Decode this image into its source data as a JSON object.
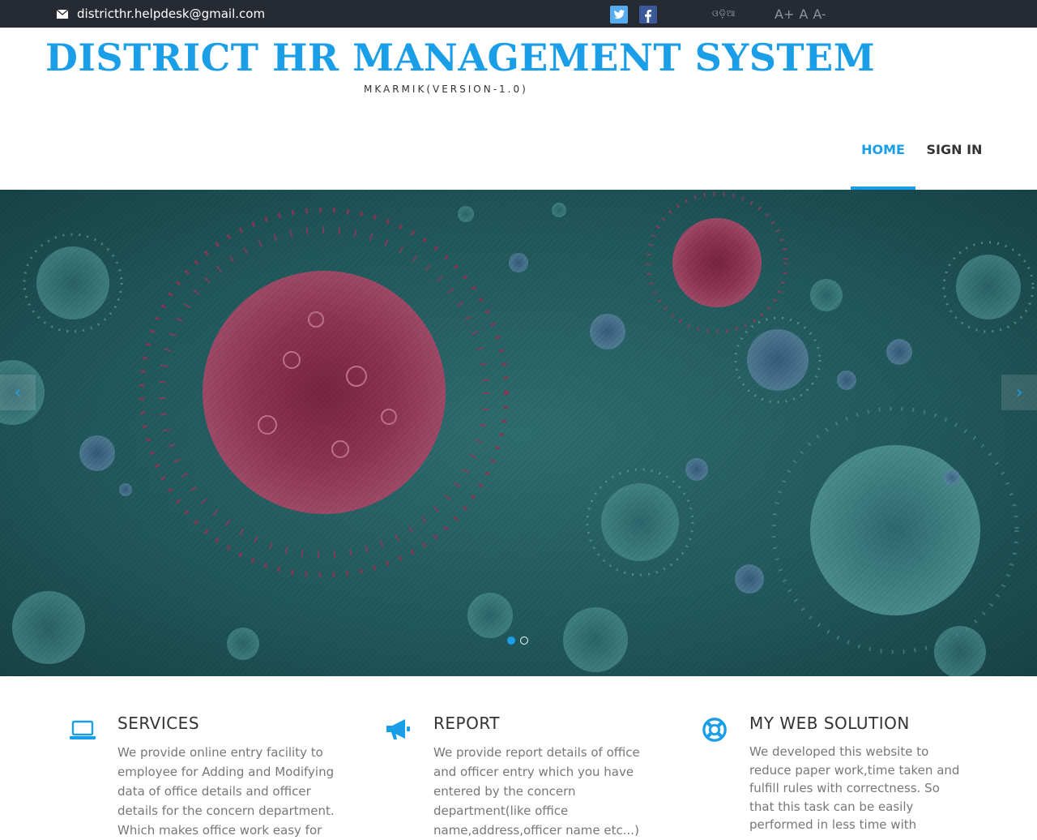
{
  "topbar": {
    "email": "districthr.helpdesk@gmail.com",
    "language_link": "ଓଡ଼ିଆ",
    "font_increase": "A+",
    "font_normal": "A",
    "font_decrease": "A-"
  },
  "header": {
    "title": "DISTRICT HR MANAGEMENT SYSTEM",
    "subtitle": "MKARMIK(VERSION-1.0)"
  },
  "nav": {
    "home": "HOME",
    "sign_in": "SIGN IN"
  },
  "slider": {
    "prev": "‹",
    "next": "›",
    "active_slide": 1,
    "slide_count": 2
  },
  "features": [
    {
      "icon": "laptop-icon",
      "title": "SERVICES",
      "text": "We provide online entry facility to employee for Adding and Modifying data of office details and officer details for the concern department. Which makes office work easy for"
    },
    {
      "icon": "megaphone-icon",
      "title": "REPORT",
      "text": "We provide report details of office and officer entry which you have entered by the concern department(like office name,address,officer name etc...)"
    },
    {
      "icon": "lifebuoy-icon",
      "title": "MY WEB SOLUTION",
      "text": "We developed this website to reduce paper work,time taken and fulfill rules with correctness. So that this task can be easily performed in less time with"
    }
  ],
  "colors": {
    "accent": "#1a9ee8",
    "topbar": "#262a32",
    "twitter": "#55acee",
    "facebook": "#3b5998"
  }
}
